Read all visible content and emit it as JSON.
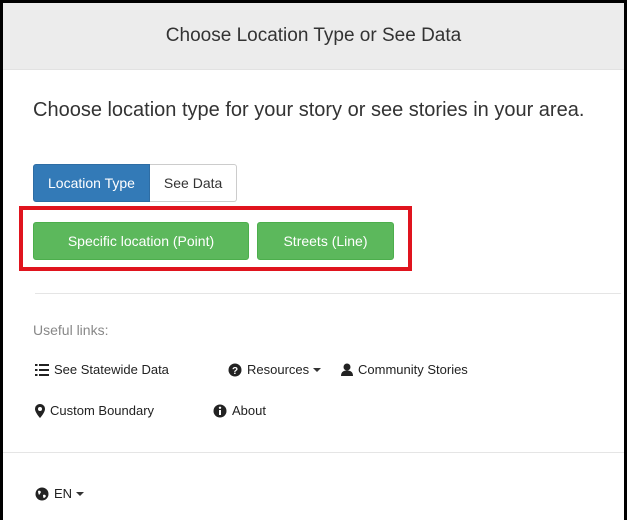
{
  "header": {
    "title": "Choose Location Type or See Data"
  },
  "main": {
    "prompt": "Choose location type for your story or see stories in your area.",
    "tabs": [
      {
        "label": "Location Type",
        "active": true
      },
      {
        "label": "See Data",
        "active": false
      }
    ],
    "actions": [
      {
        "label": "Specific location (Point)"
      },
      {
        "label": "Streets (Line)"
      }
    ],
    "useful_links_label": "Useful links:",
    "links": [
      {
        "label": "See Statewide Data",
        "icon": "list-icon"
      },
      {
        "label": "Resources",
        "icon": "question-circle-icon"
      },
      {
        "label": "Community Stories",
        "icon": "user-icon"
      },
      {
        "label": "Custom Boundary",
        "icon": "map-marker-icon"
      },
      {
        "label": "About",
        "icon": "info-circle-icon"
      }
    ]
  },
  "footer": {
    "language": "EN",
    "icon": "globe-icon"
  },
  "colors": {
    "primary": "#337ab7",
    "success": "#5cb85c",
    "highlight": "#e0141e",
    "header_bg": "#ececec"
  }
}
